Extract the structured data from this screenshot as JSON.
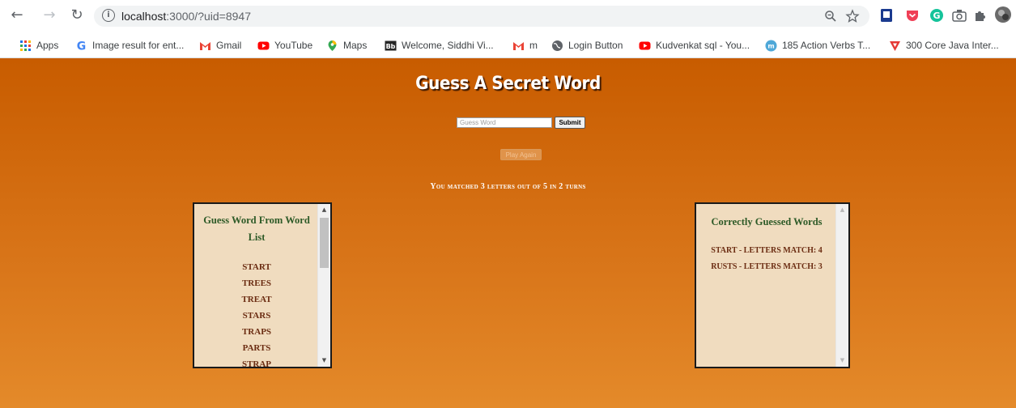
{
  "browser": {
    "url_host": "localhost",
    "url_path": ":3000/?uid=8947",
    "bookmarks": [
      {
        "label": "Apps",
        "icon": "apps-grid-icon"
      },
      {
        "label": "Image result for ent...",
        "icon": "google-icon"
      },
      {
        "label": "Gmail",
        "icon": "gmail-icon"
      },
      {
        "label": "YouTube",
        "icon": "youtube-icon"
      },
      {
        "label": "Maps",
        "icon": "maps-pin-icon"
      },
      {
        "label": "Welcome, Siddhi Vi...",
        "icon": "bb-icon"
      },
      {
        "label": "m",
        "icon": "gmail-icon"
      },
      {
        "label": "Login Button",
        "icon": "globe-icon"
      },
      {
        "label": "Kudvenkat sql - You...",
        "icon": "youtube-icon"
      },
      {
        "label": "185 Action Verbs T...",
        "icon": "m-circle-icon"
      },
      {
        "label": "300 Core Java Inter...",
        "icon": "v-logo-icon"
      }
    ]
  },
  "game": {
    "title": "Guess A Secret Word",
    "input_placeholder": "Guess Word",
    "submit_label": "Submit",
    "play_again_label": "Play Again",
    "result_text": "You matched 3 letters out of 5 in 2 turns",
    "word_list_heading": "Guess Word From Word List",
    "word_list": [
      "START",
      "TREES",
      "TREAT",
      "STARS",
      "TRAPS",
      "PARTS",
      "STRAP"
    ],
    "guessed_heading": "Correctly Guessed Words",
    "guessed_words": [
      "START - LETTERS MATCH: 4",
      "RUSTS - LETTERS MATCH: 3"
    ]
  }
}
